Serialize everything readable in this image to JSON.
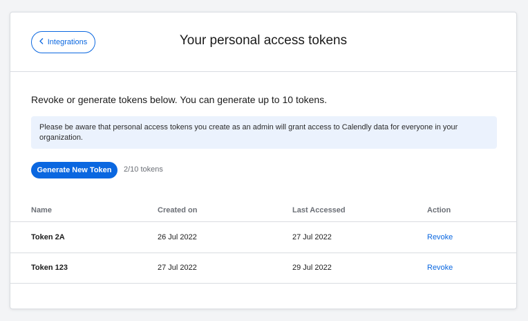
{
  "header": {
    "back_label": "Integrations",
    "title": "Your personal access tokens"
  },
  "intro": "Revoke or generate tokens below. You can generate up to 10 tokens.",
  "notice": "Please be aware that personal access tokens you create as an admin will grant access to Calendly data for everyone in your organization.",
  "generate_button": "Generate New Token",
  "token_count": "2/10 tokens",
  "table": {
    "columns": [
      "Name",
      "Created on",
      "Last Accessed",
      "Action"
    ],
    "rows": [
      {
        "name": "Token 2A",
        "created": "26 Jul 2022",
        "accessed": "27 Jul 2022",
        "action": "Revoke"
      },
      {
        "name": "Token 123",
        "created": "27 Jul 2022",
        "accessed": "29 Jul 2022",
        "action": "Revoke"
      }
    ]
  },
  "colors": {
    "accent": "#0a67e0",
    "notice_bg": "#ebf2fd",
    "border": "#d9dce1"
  },
  "icons": {
    "back": "chevron-left-icon"
  }
}
